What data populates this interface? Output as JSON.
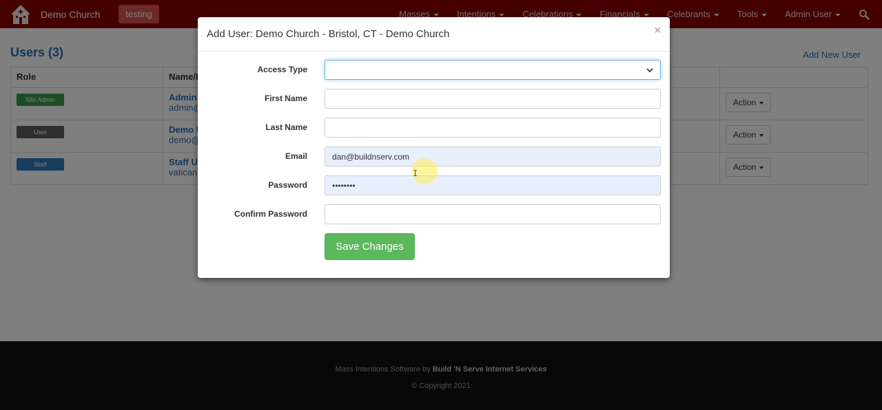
{
  "navbar": {
    "brand": "Demo Church",
    "env_badge": "testing",
    "menu": [
      "Masses",
      "Intentions",
      "Celebrations",
      "Financials",
      "Celebrants",
      "Tools",
      "Admin User"
    ],
    "icons": [
      "church-icon",
      "search-icon"
    ],
    "color": "#8b0000"
  },
  "page": {
    "title": "Users (3)",
    "add_link": "Add New User",
    "table": {
      "headers": [
        "Role",
        "Name/E"
      ],
      "rows": [
        {
          "role": "Site Admin",
          "role_color": "#3a9b47",
          "name": "Admin U",
          "email": "admin@",
          "action": "Action"
        },
        {
          "role": "User",
          "role_color": "#5c5c5c",
          "name": "Demo U",
          "email": "demo@",
          "action": "Action"
        },
        {
          "role": "Staff",
          "role_color": "#2f7bbd",
          "name": "Staff Us",
          "email": "vatican@",
          "action": "Action"
        }
      ]
    }
  },
  "modal": {
    "title": "Add User: Demo Church - Bristol, CT - Demo Church",
    "close": "×",
    "fields": {
      "access_type": {
        "label": "Access Type",
        "value": ""
      },
      "first_name": {
        "label": "First Name",
        "value": ""
      },
      "last_name": {
        "label": "Last Name",
        "value": ""
      },
      "email": {
        "label": "Email",
        "value": "dan@buildnserv.com"
      },
      "password": {
        "label": "Password",
        "value": "••••••••"
      },
      "confirm_password": {
        "label": "Confirm Password",
        "value": ""
      }
    },
    "save_button": "Save Changes",
    "save_color": "#5cb85c"
  },
  "footer": {
    "line1_prefix": "Mass Intentions Software by",
    "line1_company": "Build 'N Serve Internet Services",
    "line2": "© Copyright 2021"
  }
}
